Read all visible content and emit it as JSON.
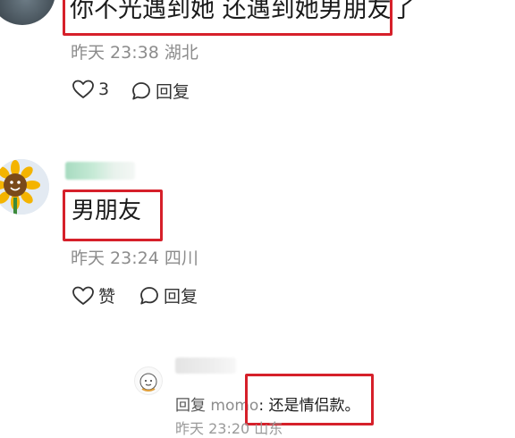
{
  "comments": [
    {
      "text": "你不光遇到她 还遇到她男朋友了",
      "date": "昨天 23:38",
      "location": "湖北",
      "like_label": "3",
      "reply_label": "回复"
    },
    {
      "text": "男朋友",
      "date": "昨天 23:24",
      "location": "四川",
      "like_label": "赞",
      "reply_label": "回复"
    }
  ],
  "sub_reply": {
    "prefix": "回复 ",
    "user": "momo",
    "text": ": 还是情侣款。",
    "meta_partial": "昨天 23:20 山东"
  },
  "colors": {
    "highlight_box": "#d6202a",
    "meta_text": "#8c8c8c",
    "blurred_name": "#a7dbc0"
  },
  "icons": [
    "heart-icon",
    "comment-bubble-icon",
    "sunflower-avatar",
    "cartoon-avatar"
  ]
}
